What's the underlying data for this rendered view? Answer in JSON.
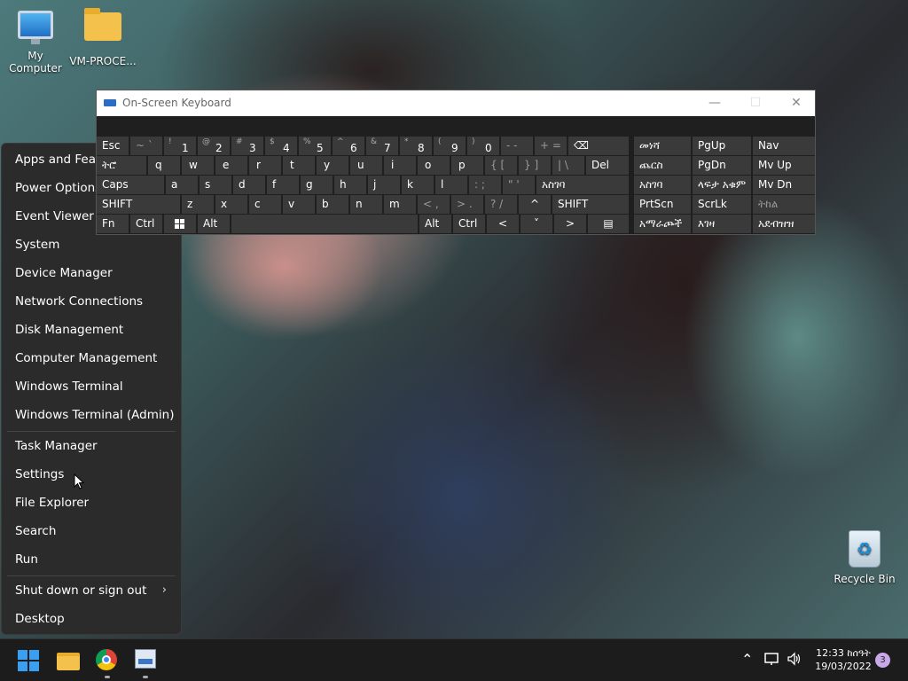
{
  "desktop": {
    "icons": [
      {
        "label": "My Computer"
      },
      {
        "label": "VM-PROCE..."
      },
      {
        "label": "Recycle Bin"
      }
    ]
  },
  "context_menu": {
    "items": [
      {
        "label": "Apps and Features"
      },
      {
        "label": "Power Options"
      },
      {
        "label": "Event Viewer"
      },
      {
        "label": "System"
      },
      {
        "label": "Device Manager"
      },
      {
        "label": "Network Connections"
      },
      {
        "label": "Disk Management"
      },
      {
        "label": "Computer Management"
      },
      {
        "label": "Windows Terminal"
      },
      {
        "label": "Windows Terminal (Admin)"
      },
      {
        "label": "Task Manager"
      },
      {
        "label": "Settings"
      },
      {
        "label": "File Explorer"
      },
      {
        "label": "Search"
      },
      {
        "label": "Run"
      },
      {
        "label": "Shut down or sign out"
      },
      {
        "label": "Desktop"
      }
    ]
  },
  "osk": {
    "title": "On-Screen Keyboard",
    "row1": {
      "esc": "Esc",
      "tilde": "~ `",
      "k1": "1",
      "k2": "2",
      "k3": "3",
      "k4": "4",
      "k5": "5",
      "k6": "6",
      "k7": "7",
      "k8": "8",
      "k9": "9",
      "k0": "0",
      "minus": "- -",
      "equals": "+ =",
      "bksp": "⌫",
      "s1": "!",
      "s2": "@",
      "s3": "#",
      "s4": "$",
      "s5": "%",
      "s6": "^",
      "s7": "&",
      "s8": "*",
      "s9": "(",
      "s0": ")"
    },
    "row2": {
      "tab": "ትሮ",
      "q": "q",
      "w": "w",
      "e": "e",
      "r": "r",
      "t": "t",
      "y": "y",
      "u": "u",
      "i": "i",
      "o": "o",
      "p": "p",
      "lbr": "{ [",
      "rbr": "} ]",
      "bsl": "| \\",
      "del": "Del"
    },
    "row3": {
      "caps": "Caps",
      "a": "a",
      "s": "s",
      "d": "d",
      "f": "f",
      "g": "g",
      "h": "h",
      "j": "j",
      "k": "k",
      "l": "l",
      "semi": ": ;",
      "quote": "\" '",
      "enter": "አስገባ"
    },
    "row4": {
      "shift1": "SHIFT",
      "z": "z",
      "x": "x",
      "c": "c",
      "v": "v",
      "b": "b",
      "n": "n",
      "m": "m",
      "comma": "< ,",
      "period": "> .",
      "slash": "? /",
      "up": "^",
      "shift2": "SHIFT"
    },
    "row5": {
      "fn": "Fn",
      "ctrl1": "Ctrl",
      "alt1": "Alt",
      "alt2": "Alt",
      "ctrl2": "Ctrl",
      "left": "<",
      "down": "˅",
      "right": ">",
      "menu": "▤"
    },
    "nav": {
      "r1": [
        "መነሻ",
        "PgUp",
        "Nav"
      ],
      "r2": [
        "ጨርስ",
        "PgDn",
        "Mv Up"
      ],
      "r3": [
        "አስገባ",
        "ላፍታ አቁም",
        "Mv Dn"
      ],
      "r4": [
        "PrtScn",
        "ScrLk",
        "ትከል"
      ],
      "r5": [
        "አማራጮች",
        "እገዛ",
        "አደብዝዝ"
      ]
    }
  },
  "taskbar": {
    "time": "12:33 ከሰዓት",
    "date": "19/03/2022",
    "notification_count": "3"
  }
}
